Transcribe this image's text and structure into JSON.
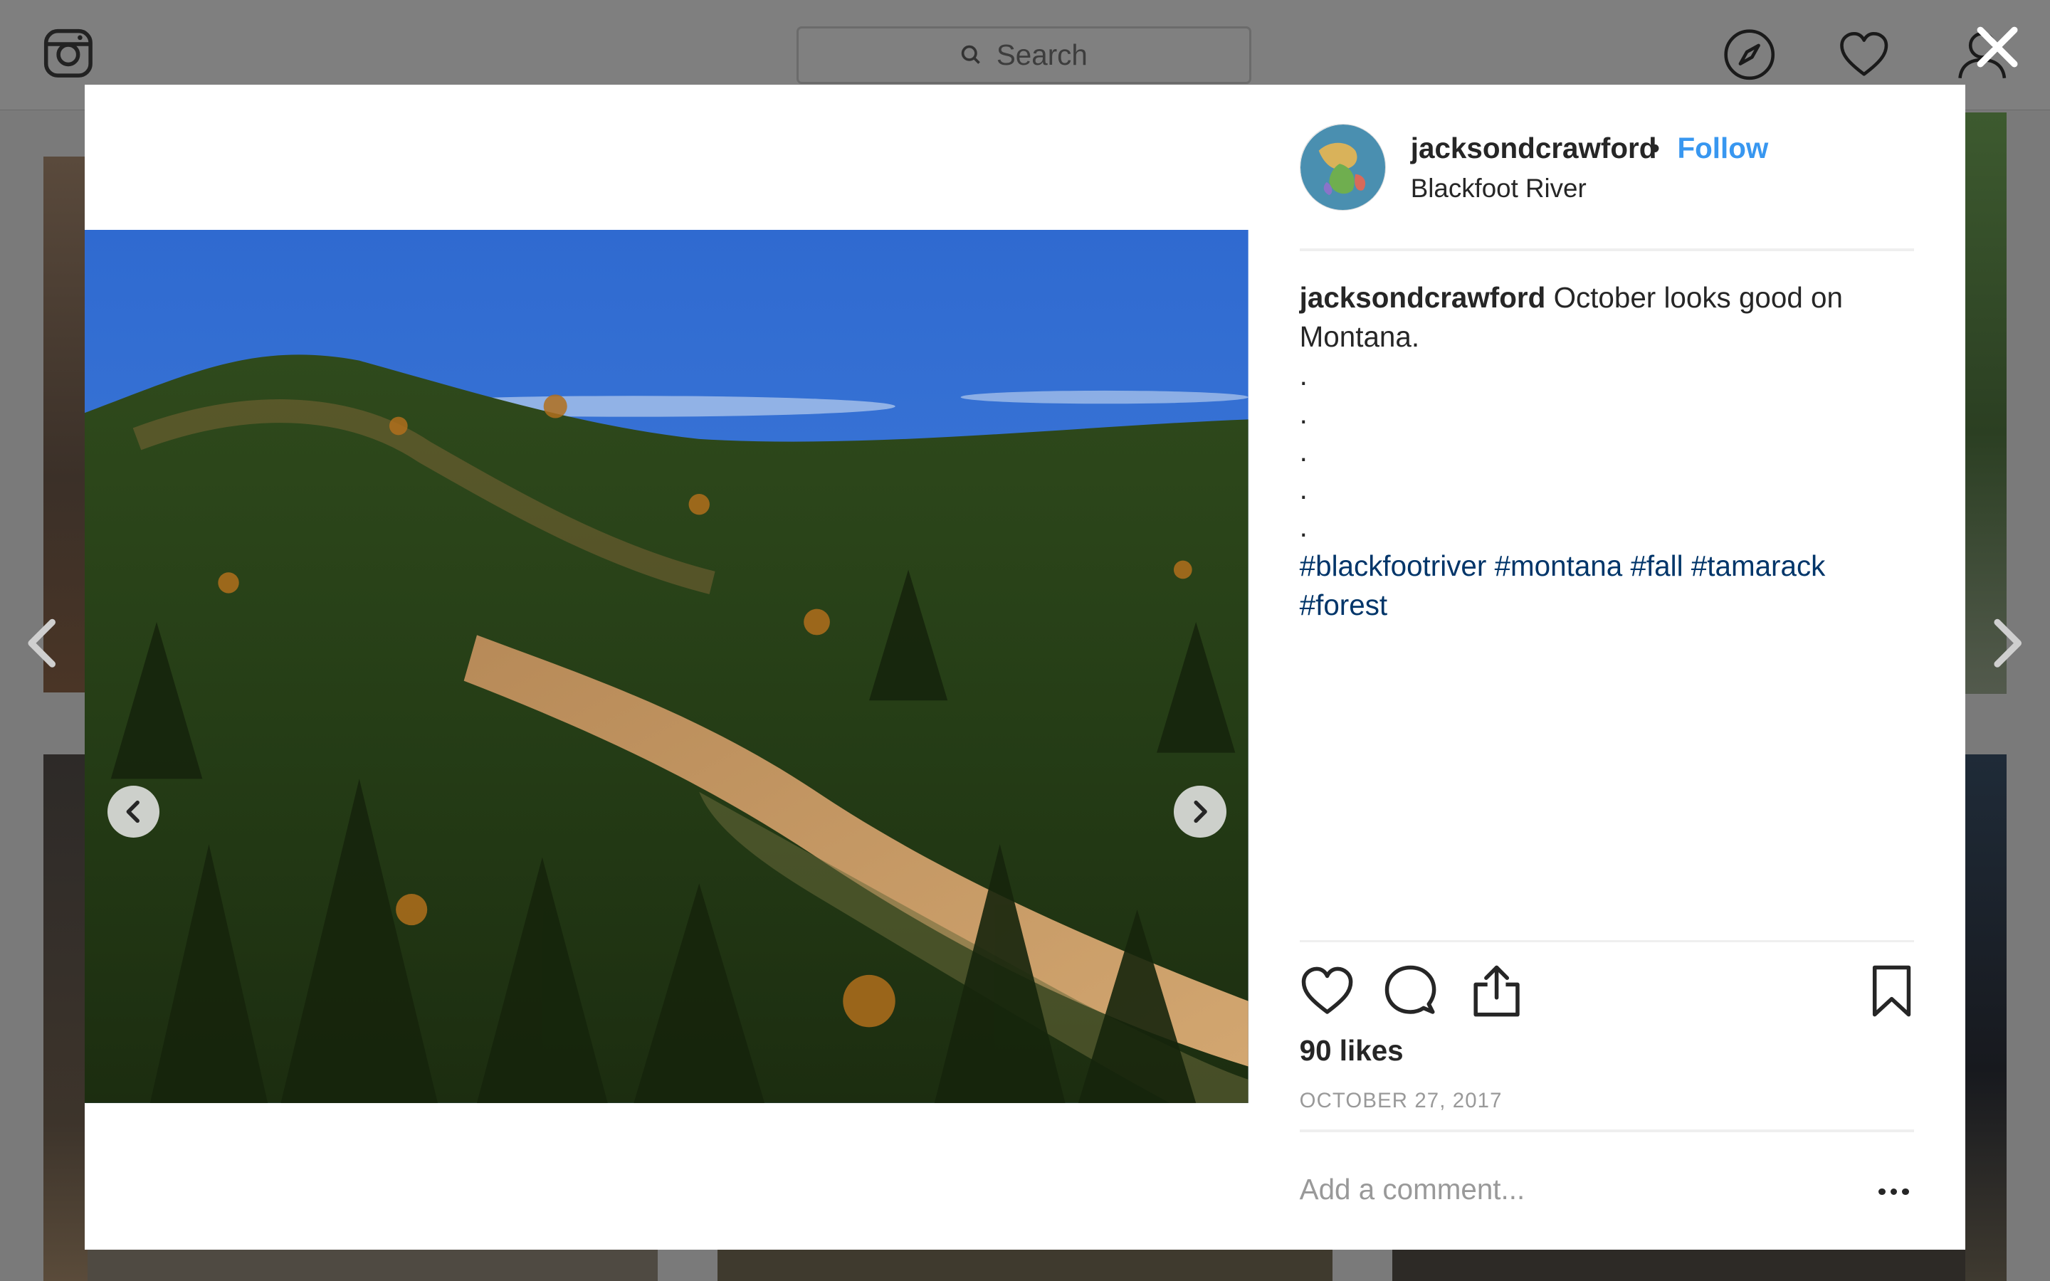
{
  "header": {
    "logo_icon": "instagram-icon",
    "search_placeholder": "Search",
    "nav_icons": [
      "compass-icon",
      "heart-icon",
      "profile-icon"
    ],
    "close_icon": "close-icon"
  },
  "post": {
    "username": "jacksondcrawford",
    "separator": "•",
    "follow_label": "Follow",
    "location": "Blackfoot River",
    "caption_user": "jacksondcrawford",
    "caption_text": "October looks good on Montana.",
    "caption_dots": [
      ".",
      ".",
      ".",
      ".",
      "."
    ],
    "hashtags": [
      "#blackfootriver",
      "#montana",
      "#fall",
      "#tamarack",
      "#forest"
    ],
    "likes": "90 likes",
    "date": "OCTOBER 27, 2017",
    "comment_placeholder": "Add a comment..."
  },
  "colors": {
    "follow": "#3897f0",
    "hashtag": "#003569",
    "text": "#262626",
    "muted": "#999999"
  }
}
